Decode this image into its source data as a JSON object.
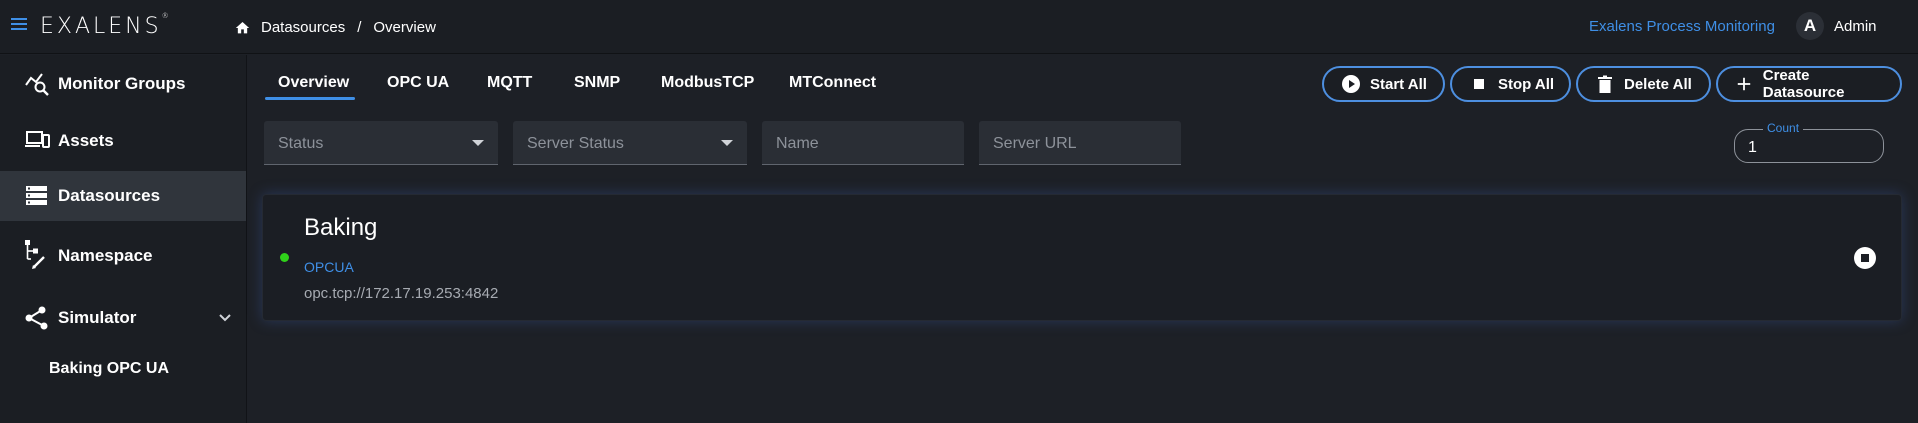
{
  "header": {
    "logo": "EXALENS",
    "logo_mark": "®",
    "breadcrumb": [
      "Datasources",
      "Overview"
    ],
    "breadcrumb_separator": "/",
    "app_link": "Exalens Process Monitoring",
    "user": {
      "initial": "A",
      "name": "Admin"
    }
  },
  "sidebar": {
    "items": [
      {
        "label": "Monitor Groups",
        "icon": "monitor-groups-icon"
      },
      {
        "label": "Assets",
        "icon": "devices-icon"
      },
      {
        "label": "Datasources",
        "icon": "storage-icon",
        "active": true
      },
      {
        "label": "Namespace",
        "icon": "tree-edit-icon"
      },
      {
        "label": "Simulator",
        "icon": "share-icon",
        "expanded": true
      }
    ],
    "sub_items": [
      {
        "label": "Baking OPC UA"
      }
    ]
  },
  "tabs": [
    {
      "label": "Overview",
      "active": true
    },
    {
      "label": "OPC UA"
    },
    {
      "label": "MQTT"
    },
    {
      "label": "SNMP"
    },
    {
      "label": "ModbusTCP"
    },
    {
      "label": "MTConnect"
    }
  ],
  "actions": {
    "start_all": "Start All",
    "stop_all": "Stop All",
    "delete_all": "Delete All",
    "create": "Create Datasource"
  },
  "filters": {
    "status": "Status",
    "server_status": "Server Status",
    "name": "Name",
    "server_url": "Server URL"
  },
  "count": {
    "label": "Count",
    "value": "1"
  },
  "datasources": [
    {
      "name": "Baking",
      "type": "OPCUA",
      "url": "opc.tcp://172.17.19.253:4842",
      "status_color": "#2fd11a"
    }
  ],
  "colors": {
    "accent": "#3f8fe6",
    "background": "#1d2026",
    "sidebar": "#1b1e23",
    "active_item": "#30353c"
  }
}
